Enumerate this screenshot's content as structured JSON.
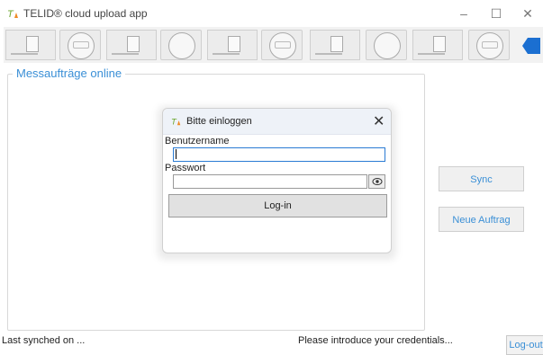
{
  "window": {
    "title": "TELID® cloud upload app",
    "minimize": "–",
    "maximize": "☐",
    "close": "✕"
  },
  "strip": {
    "thumbnails": [
      "label",
      "round",
      "label",
      "round",
      "label",
      "round",
      "label",
      "round",
      "label",
      "round"
    ],
    "next_icon": "arrow-right-icon"
  },
  "main": {
    "group_title": "Messaufträge online",
    "sync_label": "Sync",
    "new_order_label": "Neue Auftrag"
  },
  "login_dialog": {
    "title": "Bitte einloggen",
    "close": "✕",
    "username_label": "Benutzername",
    "username_value": "",
    "password_label": "Passwort",
    "password_value": "",
    "show_password_icon": "eye-icon",
    "login_label": "Log-in"
  },
  "status": {
    "last_synched": "Last synched on ...",
    "message": "Please introduce your credentials...",
    "logout_label": "Log-out"
  },
  "colors": {
    "accent": "#3a8fd6",
    "logo_green": "#6aa52b",
    "logo_orange": "#f08a24"
  }
}
